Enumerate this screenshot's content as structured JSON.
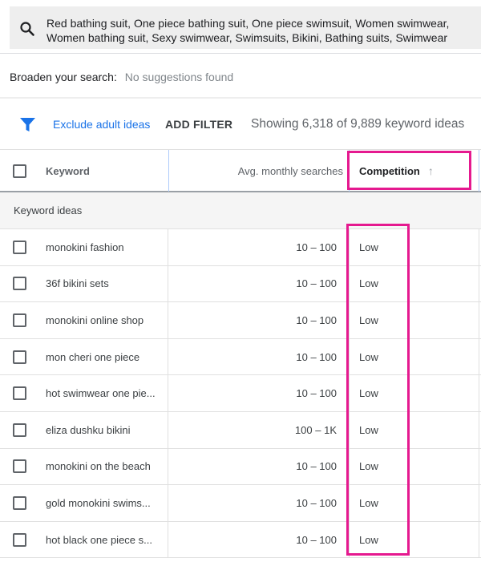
{
  "search": {
    "icon": "search-icon",
    "line1": "Red bathing suit, One piece bathing suit, One piece swimsuit, Women swimwear,",
    "line2": "Women bathing suit, Sexy swimwear, Swimsuits, Bikini, Bathing suits, Swimwear"
  },
  "broaden": {
    "label": "Broaden your search:",
    "value": "No suggestions found"
  },
  "filters": {
    "icon": "filter-icon",
    "exclude_label": "Exclude adult ideas",
    "add_filter_label": "ADD FILTER",
    "showing_text": "Showing 6,318 of 9,889 keyword ideas"
  },
  "table": {
    "columns": {
      "keyword": "Keyword",
      "avg_monthly_searches": "Avg. monthly searches",
      "competition": "Competition",
      "competition_sort": "↑"
    },
    "group_label": "Keyword ideas",
    "rows": [
      {
        "keyword": "monokini fashion",
        "avg": "10 – 100",
        "competition": "Low"
      },
      {
        "keyword": "36f bikini sets",
        "avg": "10 – 100",
        "competition": "Low"
      },
      {
        "keyword": "monokini online shop",
        "avg": "10 – 100",
        "competition": "Low"
      },
      {
        "keyword": "mon cheri one piece",
        "avg": "10 – 100",
        "competition": "Low"
      },
      {
        "keyword": "hot swimwear one pie...",
        "avg": "10 – 100",
        "competition": "Low"
      },
      {
        "keyword": "eliza dushku bikini",
        "avg": "100 – 1K",
        "competition": "Low"
      },
      {
        "keyword": "monokini on the beach",
        "avg": "10 – 100",
        "competition": "Low"
      },
      {
        "keyword": "gold monokini swims...",
        "avg": "10 – 100",
        "competition": "Low"
      },
      {
        "keyword": "hot black one piece s...",
        "avg": "10 – 100",
        "competition": "Low"
      }
    ]
  },
  "colors": {
    "accent_blue": "#1a73e8",
    "highlight_magenta": "#e5198f"
  }
}
